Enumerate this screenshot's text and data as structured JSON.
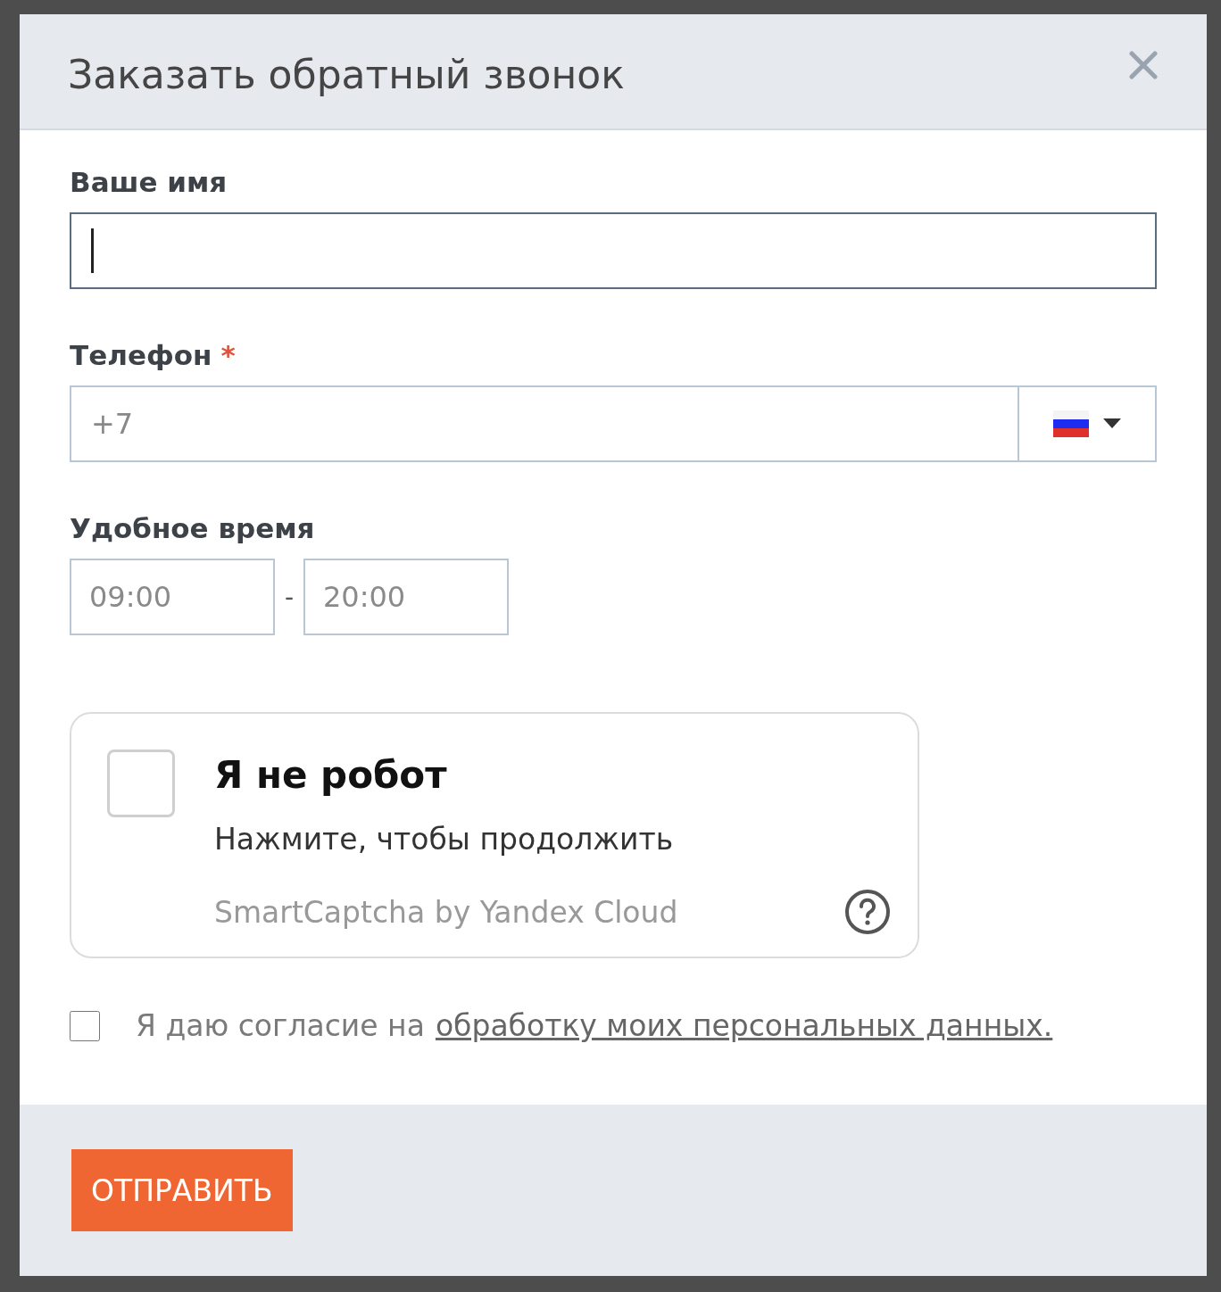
{
  "dialog": {
    "title": "Заказать обратный звонок"
  },
  "name_field": {
    "label": "Ваше имя",
    "focused": true
  },
  "phone_field": {
    "label": "Телефон",
    "required": true,
    "required_mark": "*",
    "placeholder": "+7"
  },
  "time_field": {
    "label": "Удобное время",
    "from_placeholder": "09:00",
    "separator": "-",
    "to_placeholder": "20:00"
  },
  "captcha": {
    "checked": false,
    "title": "Я не робот",
    "subtitle": "Нажмите, чтобы продолжить",
    "provider": "SmartCaptcha by Yandex Cloud"
  },
  "consent": {
    "checked": false,
    "text": "Я даю согласие на",
    "link": "обработку моих персональных данных."
  },
  "submit_button": "ОТПРАВИТЬ"
}
